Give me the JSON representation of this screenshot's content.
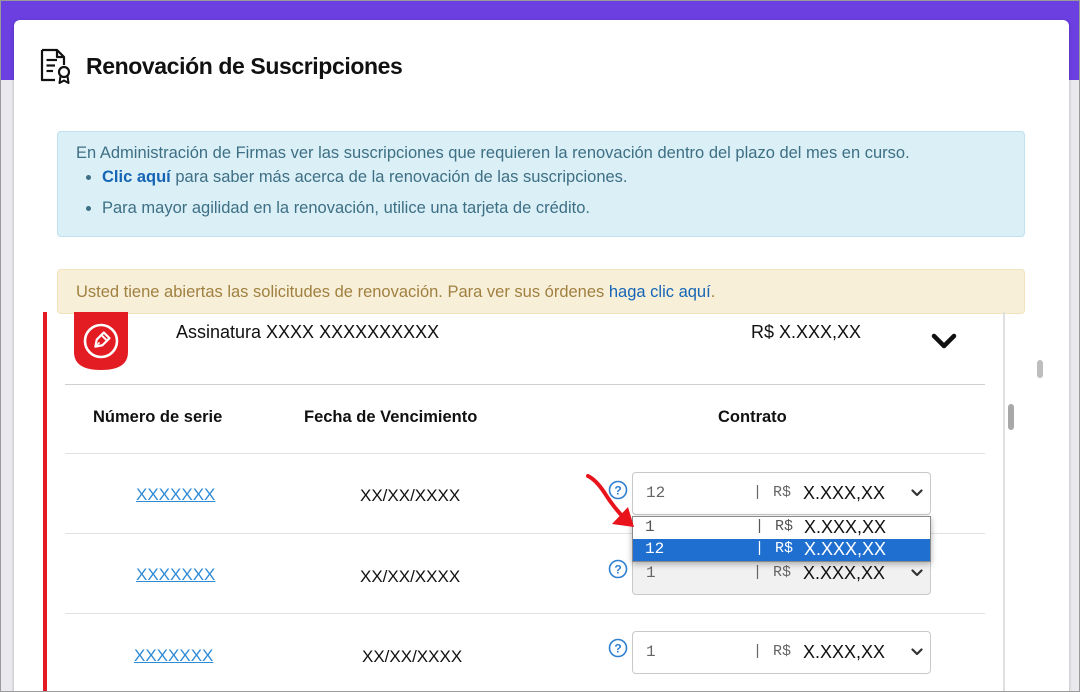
{
  "page": {
    "title": "Renovación de Suscripciones",
    "icon": "certificate-document-icon"
  },
  "info_alert": {
    "intro": "En Administración de Firmas ver las suscripciones que requieren la renovación dentro del plazo del mes en curso.",
    "bullet1_link": "Clic aquí",
    "bullet1_text": " para saber más acerca de la renovación de las suscripciones.",
    "bullet2_text": "Para mayor agilidad en la renovación, utilice una tarjeta de crédito."
  },
  "warning_alert": {
    "text": "Usted tiene abiertas las solicitudes de renovación. Para ver sus órdenes ",
    "link": "haga clic aquí",
    "suffix": "."
  },
  "product": {
    "name": "Assinatura XXXX XXXXXXXXXX",
    "price": "R$ X.XXX,XX",
    "badge_icon": "pen-nib-icon",
    "badge_color": "#e31b23"
  },
  "table": {
    "headers": {
      "serial": "Número de serie",
      "expiry": "Fecha de Vencimiento",
      "contract": "Contrato"
    },
    "rows": [
      {
        "serial": "XXXXXXX",
        "expiry": "XX/XX/XXXX",
        "contract_num": "12",
        "sep": "|",
        "currency": "R$",
        "price": "X.XXX,XX"
      },
      {
        "serial": "XXXXXXX",
        "expiry": "XX/XX/XXXX",
        "contract_num": "1",
        "sep": "|",
        "currency": "R$",
        "price": "X.XXX,XX"
      },
      {
        "serial": "XXXXXXX",
        "expiry": "XX/XX/XXXX",
        "contract_num": "1",
        "sep": "|",
        "currency": "R$",
        "price": "X.XXX,XX"
      }
    ]
  },
  "dropdown": {
    "options": [
      {
        "num": "1",
        "sep": "|",
        "currency": "R$",
        "price": "X.XXX,XX",
        "selected": false
      },
      {
        "num": "12",
        "sep": "|",
        "currency": "R$",
        "price": "X.XXX,XX",
        "selected": true
      }
    ]
  },
  "colors": {
    "accent": "#6b3fe0",
    "link": "#1665b5",
    "selection": "#1e6fd0",
    "annotation_arrow": "#e8131b"
  }
}
